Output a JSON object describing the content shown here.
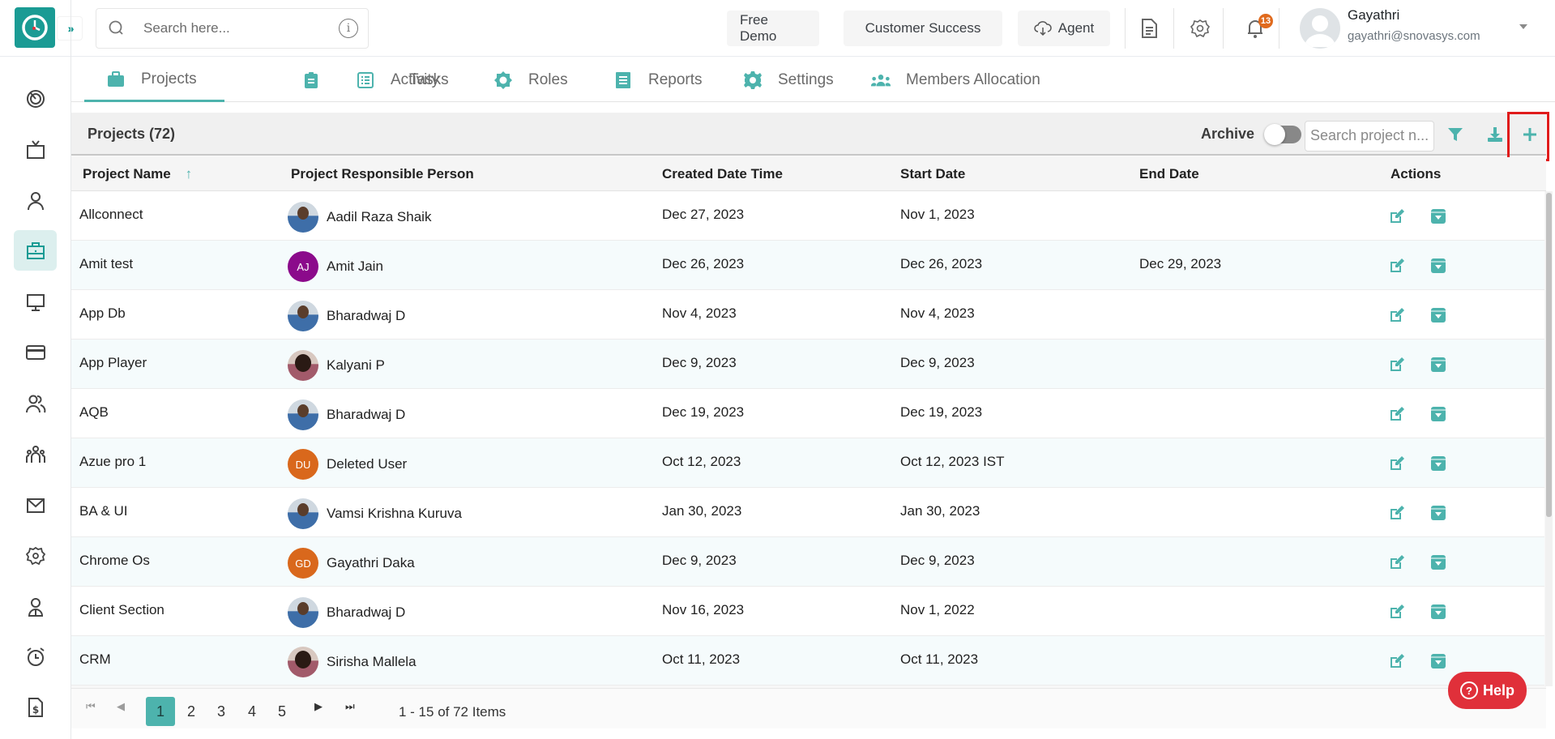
{
  "header": {
    "search_placeholder": "Search here...",
    "buttons": {
      "free_demo": "Free Demo",
      "customer_success": "Customer Success",
      "agent": "Agent"
    },
    "notification_count": "13",
    "user": {
      "name": "Gayathri",
      "email": "gayathri@snovasys.com"
    }
  },
  "sidebar": {
    "items": [
      {
        "icon": "radar-icon"
      },
      {
        "icon": "tv-icon"
      },
      {
        "icon": "user-icon"
      },
      {
        "icon": "briefcase-icon",
        "active": true
      },
      {
        "icon": "monitor-icon"
      },
      {
        "icon": "credit-card-icon"
      },
      {
        "icon": "users-icon"
      },
      {
        "icon": "team-icon"
      },
      {
        "icon": "mail-icon"
      },
      {
        "icon": "settings-icon"
      },
      {
        "icon": "employee-icon"
      },
      {
        "icon": "alarm-icon"
      },
      {
        "icon": "invoice-icon"
      }
    ]
  },
  "tabs": [
    {
      "label": "Projects",
      "active": true
    },
    {
      "label": "Tasks"
    },
    {
      "label": "Activity"
    },
    {
      "label": "Roles"
    },
    {
      "label": "Reports"
    },
    {
      "label": "Settings"
    },
    {
      "label": "Members Allocation"
    }
  ],
  "projects": {
    "title": "Projects (72)",
    "archive_label": "Archive",
    "archive_on": false,
    "search_placeholder": "Search project n...",
    "columns": [
      "Project Name",
      "Project Responsible Person",
      "Created Date Time",
      "Start Date",
      "End Date",
      "Actions"
    ],
    "sort_indicator": "↑",
    "rows": [
      {
        "name": "Allconnect",
        "person": "Aadil Raza Shaik",
        "avatar": "photo",
        "initials": "",
        "avatar_color": "",
        "created": "Dec 27, 2023",
        "start": "Nov 1, 2023",
        "end": ""
      },
      {
        "name": "Amit test",
        "person": "Amit Jain",
        "avatar": "initials",
        "initials": "AJ",
        "avatar_color": "#8b0a8b",
        "created": "Dec 26, 2023",
        "start": "Dec 26, 2023",
        "end": "Dec 29, 2023"
      },
      {
        "name": "App Db",
        "person": "Bharadwaj D",
        "avatar": "photo",
        "initials": "",
        "avatar_color": "",
        "created": "Nov 4, 2023",
        "start": "Nov 4, 2023",
        "end": ""
      },
      {
        "name": "App Player",
        "person": "Kalyani P",
        "avatar": "photo-f",
        "initials": "",
        "avatar_color": "",
        "created": "Dec 9, 2023",
        "start": "Dec 9, 2023",
        "end": ""
      },
      {
        "name": "AQB",
        "person": "Bharadwaj D",
        "avatar": "photo",
        "initials": "",
        "avatar_color": "",
        "created": "Dec 19, 2023",
        "start": "Dec 19, 2023",
        "end": ""
      },
      {
        "name": "Azue pro 1",
        "person": "Deleted User",
        "avatar": "initials",
        "initials": "DU",
        "avatar_color": "#d9681c",
        "created": "Oct 12, 2023",
        "start": "Oct 12, 2023 IST",
        "end": ""
      },
      {
        "name": "BA & UI",
        "person": "Vamsi Krishna Kuruva",
        "avatar": "photo",
        "initials": "",
        "avatar_color": "",
        "created": "Jan 30, 2023",
        "start": "Jan 30, 2023",
        "end": ""
      },
      {
        "name": "Chrome Os",
        "person": "Gayathri Daka",
        "avatar": "initials",
        "initials": "GD",
        "avatar_color": "#d9681c",
        "created": "Dec 9, 2023",
        "start": "Dec 9, 2023",
        "end": ""
      },
      {
        "name": "Client Section",
        "person": "Bharadwaj D",
        "avatar": "photo",
        "initials": "",
        "avatar_color": "",
        "created": "Nov 16, 2023",
        "start": "Nov 1, 2022",
        "end": ""
      },
      {
        "name": "CRM",
        "person": "Sirisha Mallela",
        "avatar": "photo-f",
        "initials": "",
        "avatar_color": "",
        "created": "Oct 11, 2023",
        "start": "Oct 11, 2023",
        "end": ""
      }
    ]
  },
  "pagination": {
    "pages": [
      "1",
      "2",
      "3",
      "4",
      "5"
    ],
    "current": "1",
    "info": "1 - 15 of 72 Items"
  },
  "help_label": "Help",
  "colors": {
    "brand": "#1a9b94",
    "accent": "#4db3ad",
    "help": "#e0303a",
    "badge": "#e06a1d",
    "highlight": "#e01b1b"
  }
}
